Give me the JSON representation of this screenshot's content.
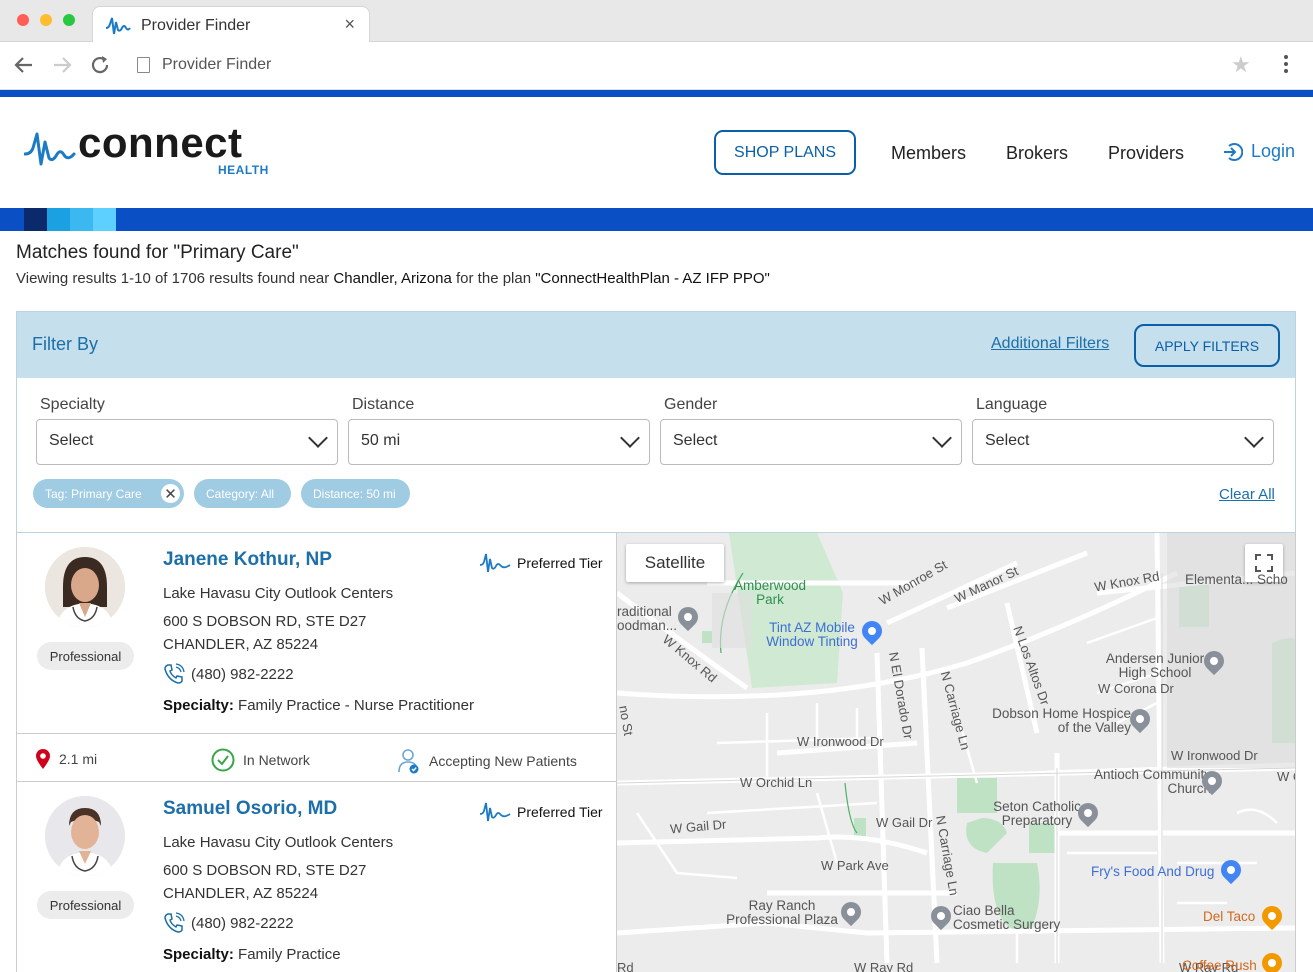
{
  "browser": {
    "tab_title": "Provider Finder",
    "tab_close": "×",
    "url": "Provider Finder"
  },
  "header": {
    "logo_text": "connect",
    "logo_sub": "HEALTH",
    "shop_plans": "SHOP PLANS",
    "nav": [
      "Members",
      "Brokers",
      "Providers"
    ],
    "login": "Login"
  },
  "results": {
    "heading": "Matches found for \"Primary Care\"",
    "summary_pre": "Viewing results 1-10 of 1706 results found near ",
    "location": "Chandler, Arizona",
    "summary_mid": " for the plan ",
    "plan": "\"ConnectHealthPlan - AZ IFP PPO\""
  },
  "filter": {
    "title": "Filter By",
    "additional": "Additional Filters",
    "apply": "APPLY FILTERS",
    "fields": [
      {
        "label": "Specialty",
        "value": "Select"
      },
      {
        "label": "Distance",
        "value": "50 mi"
      },
      {
        "label": "Gender",
        "value": "Select"
      },
      {
        "label": "Language",
        "value": "Select"
      }
    ],
    "chips": [
      "Tag: Primary Care",
      "Category: All",
      "Distance: 50 mi"
    ],
    "clear_all": "Clear All"
  },
  "providers": [
    {
      "name": "Janene Kothur, NP",
      "type": "Professional",
      "tier": "Preferred Tier",
      "org": "Lake Havasu City Outlook Centers",
      "address1": "600 S DOBSON RD, STE D27",
      "address2": "CHANDLER, AZ 85224",
      "phone": "(480) 982-2222",
      "specialty_label": "Specialty:",
      "specialty": "Family Practice - Nurse Practitioner",
      "distance": "2.1 mi",
      "network": "In Network",
      "accepting": "Accepting New Patients"
    },
    {
      "name": "Samuel Osorio, MD",
      "type": "Professional",
      "tier": "Preferred Tier",
      "org": "Lake Havasu City Outlook Centers",
      "address1": "600 S DOBSON RD, STE D27",
      "address2": "CHANDLER, AZ 85224",
      "phone": "(480) 982-2222",
      "specialty_label": "Specialty:",
      "specialty": "Family Practice"
    }
  ],
  "map": {
    "satellite": "Satellite",
    "streets": [
      "W Monroe St",
      "W Manor St",
      "W Knox Rd",
      "W Knox Rd",
      "N El Dorado Dr",
      "N Carriage Ln",
      "N Los Altos Dr",
      "W Corona Dr",
      "W Ironwood Dr",
      "W Ironwood Dr",
      "W Orchid Ln",
      "W Gail Dr",
      "W Gail Dr",
      "W Park Ave",
      "N Carriage Ln",
      "W Ray Rd",
      "W Ray Rd",
      "Rd",
      "no St",
      "W C"
    ],
    "places": {
      "amberwood": "Amberwood Park",
      "traditional": "raditional oodman...",
      "tint": "Tint AZ Mobile Window Tinting",
      "elementary": "Elementa... Scho",
      "andersen": "Andersen Junior High School",
      "dobson": "Dobson Home Hospice of the Valley",
      "antioch": "Antioch Community Church",
      "seton": "Seton Catholic Preparatory",
      "frys": "Fry's Food And Drug",
      "ray_ranch": "Ray Ranch Professional Plaza",
      "ciao": "Ciao Bella Cosmetic Surgery",
      "del_taco": "Del Taco",
      "coffee": "Coffee Rush"
    }
  },
  "colors": {
    "brand_blue": "#0b4fc4",
    "link_blue": "#1c6fa8",
    "filter_bg": "#c5dfec",
    "chip_bg": "#9fcbe3"
  }
}
